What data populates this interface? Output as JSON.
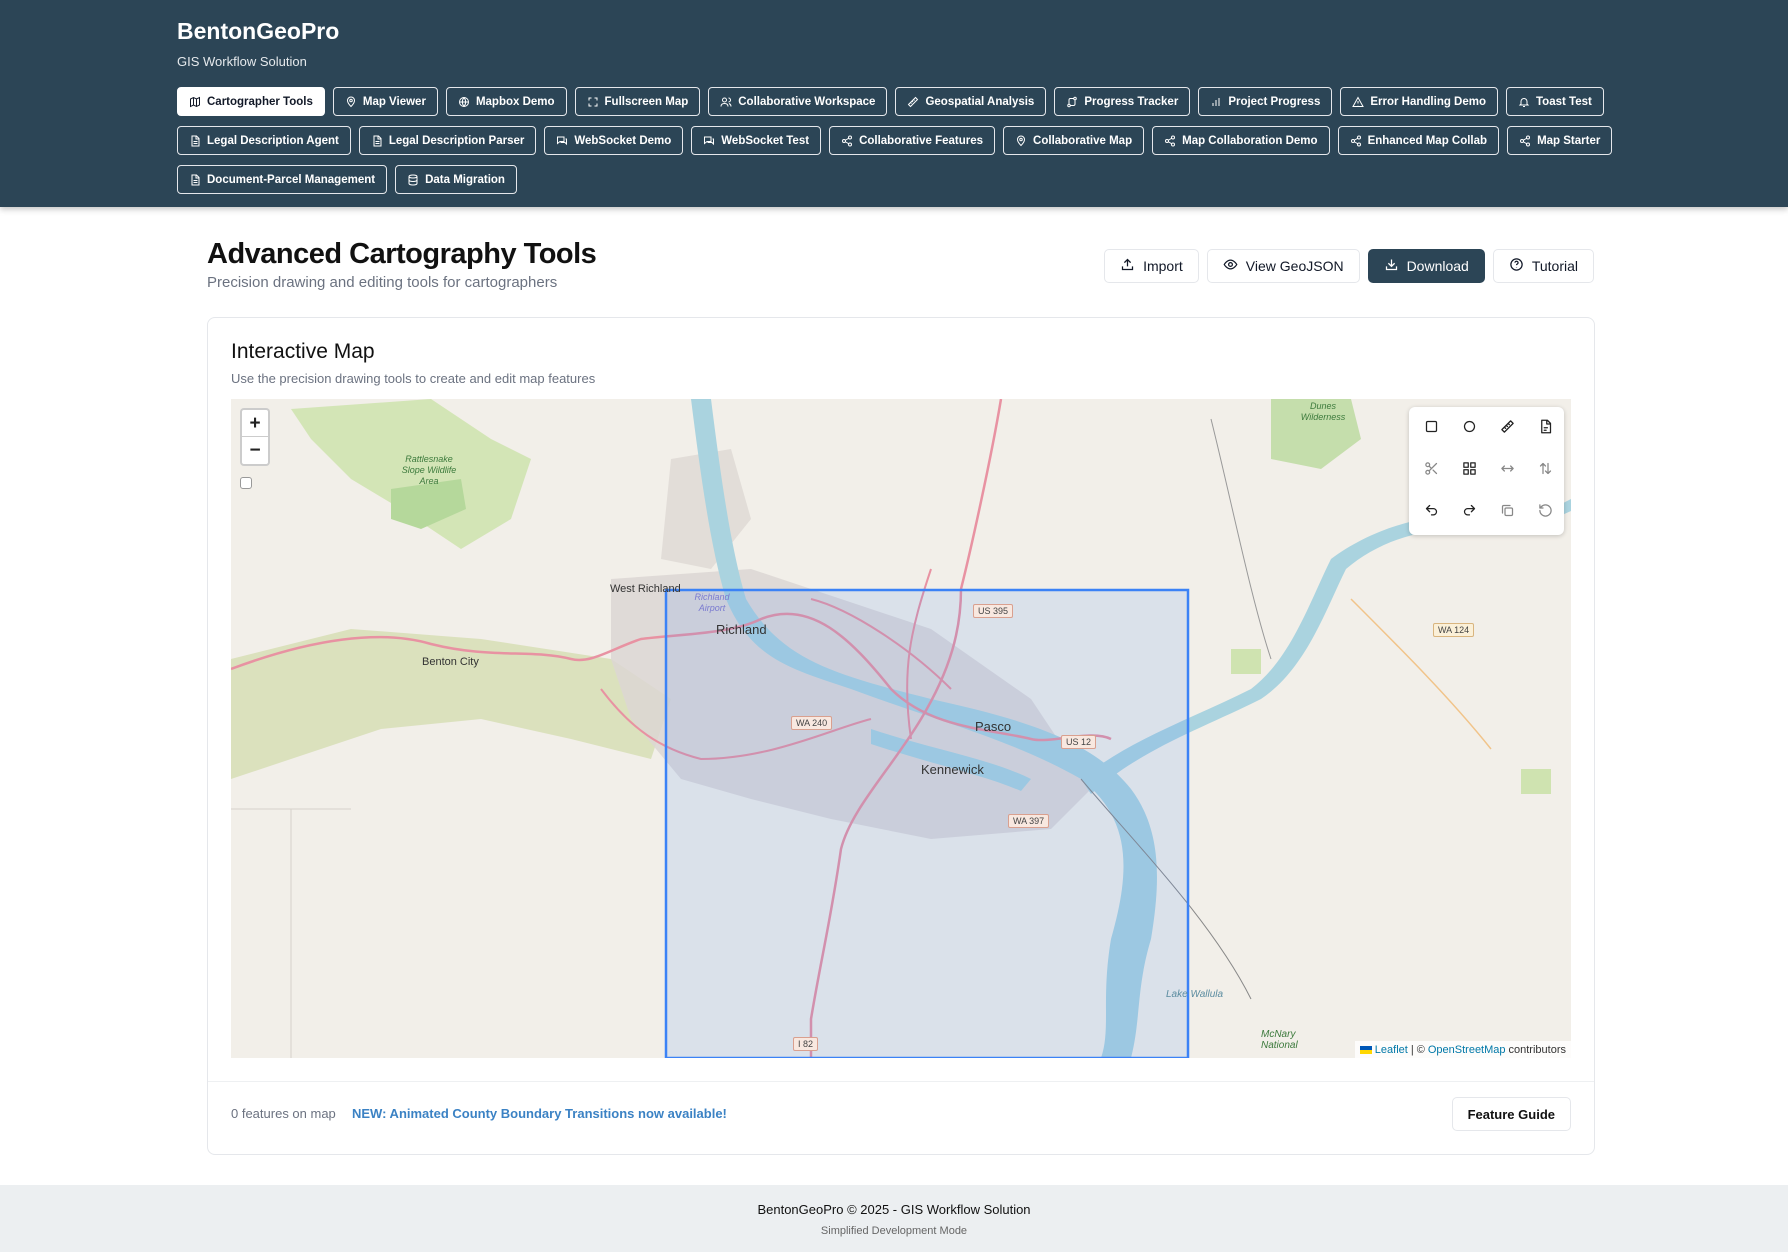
{
  "app": {
    "title": "BentonGeoPro",
    "tagline": "GIS Workflow Solution"
  },
  "nav": {
    "row1": [
      {
        "label": "Cartographer Tools",
        "icon": "map-icon"
      },
      {
        "label": "Map Viewer",
        "icon": "pin-icon"
      },
      {
        "label": "Mapbox Demo",
        "icon": "globe-icon"
      },
      {
        "label": "Fullscreen Map",
        "icon": "expand-icon"
      },
      {
        "label": "Collaborative Workspace",
        "icon": "users-icon"
      },
      {
        "label": "Geospatial Analysis",
        "icon": "ruler-icon"
      },
      {
        "label": "Progress Tracker",
        "icon": "route-icon"
      },
      {
        "label": "Project Progress",
        "icon": "bar-chart-icon"
      },
      {
        "label": "Error Handling Demo",
        "icon": "warning-icon"
      },
      {
        "label": "Toast Test",
        "icon": "bell-icon"
      }
    ],
    "row2": [
      {
        "label": "Legal Description Agent",
        "icon": "document-icon"
      },
      {
        "label": "Legal Description Parser",
        "icon": "document-icon"
      },
      {
        "label": "WebSocket Demo",
        "icon": "chat-icon"
      },
      {
        "label": "WebSocket Test",
        "icon": "chat-icon"
      },
      {
        "label": "Collaborative Features",
        "icon": "share-icon"
      },
      {
        "label": "Collaborative Map",
        "icon": "pin-icon"
      },
      {
        "label": "Map Collaboration Demo",
        "icon": "share-icon"
      },
      {
        "label": "Enhanced Map Collab",
        "icon": "share-icon"
      },
      {
        "label": "Map Starter",
        "icon": "share-icon"
      }
    ],
    "row3": [
      {
        "label": "Document-Parcel Management",
        "icon": "document-icon"
      },
      {
        "label": "Data Migration",
        "icon": "database-icon"
      }
    ]
  },
  "page": {
    "title": "Advanced Cartography Tools",
    "subtitle": "Precision drawing and editing tools for cartographers",
    "actions": {
      "import": "Import",
      "view_geojson": "View GeoJSON",
      "download": "Download",
      "tutorial": "Tutorial"
    }
  },
  "card": {
    "title": "Interactive Map",
    "subtitle": "Use the precision drawing tools to create and edit map features",
    "feature_count": "0 features on map",
    "promo": "NEW: Animated County Boundary Transitions now available!",
    "guide_button": "Feature Guide"
  },
  "map": {
    "zoom_in": "+",
    "zoom_out": "−",
    "labels": {
      "richland": "Richland",
      "west_richland": "West Richland",
      "benton_city": "Benton City",
      "pasco": "Pasco",
      "kennewick": "Kennewick",
      "airport": "Richland Airport",
      "rattlesnake": "Rattlesnake Slope Wildlife Area",
      "dunes": "Dunes Wilderness",
      "lake_wallula": "Lake Wallula",
      "mcnary": "McNary National"
    },
    "shields": [
      "US 395",
      "WA 124",
      "WA 240",
      "US 12",
      "WA 397",
      "I 82",
      "US 395"
    ],
    "attribution": {
      "leaflet": "Leaflet",
      "sep": "| ©",
      "osm": "OpenStreetMap",
      "suffix": "contributors"
    },
    "selection_color": "#3b82f6"
  },
  "footer": {
    "line1": "BentonGeoPro © 2025 - GIS Workflow Solution",
    "line2": "Simplified Development Mode"
  }
}
